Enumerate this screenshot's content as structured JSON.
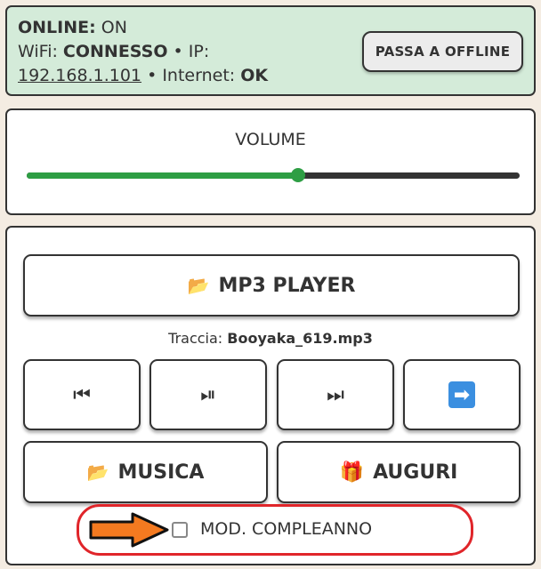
{
  "status": {
    "online_label": "ONLINE:",
    "online_value": "ON",
    "wifi_label": "WiFi:",
    "wifi_value": "CONNESSO",
    "ip_label": "IP:",
    "ip_value": "192.168.1.101",
    "internet_label": "Internet:",
    "internet_value": "OK",
    "offline_button": "PASSA A OFFLINE"
  },
  "volume": {
    "label": "VOLUME",
    "level_fraction": 0.55,
    "colors": {
      "fill": "#2e9e44",
      "track": "#333333"
    }
  },
  "player": {
    "mp3_button": "MP3 PLAYER",
    "track_label": "Traccia:",
    "track_name": "Booyaka_619.mp3",
    "controls": [
      {
        "icon": "previous-track-icon",
        "glyph": "⏮"
      },
      {
        "icon": "play-pause-icon",
        "glyph": "⏯"
      },
      {
        "icon": "next-track-icon",
        "glyph": "⏭"
      },
      {
        "icon": "right-arrow-icon",
        "glyph": "➡"
      }
    ],
    "music_button": "MUSICA",
    "greetings_button": "AUGURI",
    "birthday_mode_label": "MOD. COMPLEANNO",
    "birthday_mode_checked": false
  },
  "colors": {
    "status_bg": "#d4ebd9",
    "page_bg": "#f4ece2",
    "highlight_outline": "#e0252a",
    "arrow_fill": "#f47a20"
  }
}
